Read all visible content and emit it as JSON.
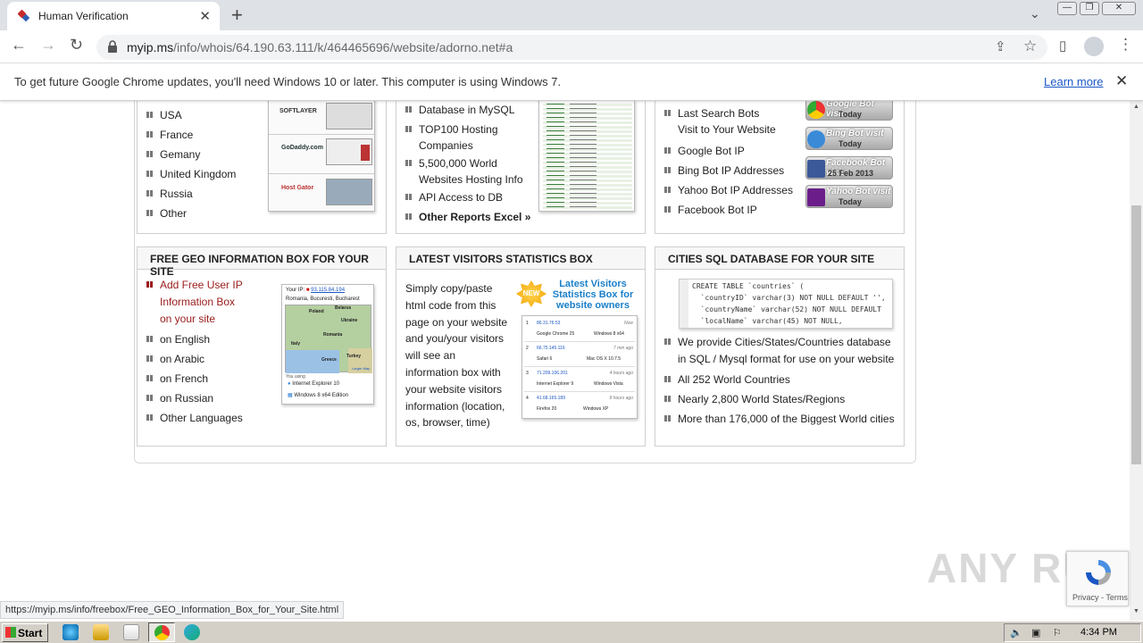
{
  "browser": {
    "tab_title": "Human Verification",
    "tab_close": "✕",
    "new_tab": "+",
    "tab_search": "⌄",
    "win_min": "—",
    "win_max": "❐",
    "win_close": "✕",
    "url_host": "myip.ms",
    "url_path": "/info/whois/64.190.63.111/k/464465696/website/adorno.net#a",
    "back": "←",
    "forward": "→",
    "reload": "↻",
    "share": "⇪",
    "star": "☆",
    "sidepanel": "▯",
    "menu": "⋮"
  },
  "infobar": {
    "message": "To get future Google Chrome updates, you'll need Windows 10 or later. This computer is using Windows 7.",
    "learn_more": "Learn more",
    "close": "✕"
  },
  "top_row": {
    "col1_items": [
      "USA",
      "France",
      "Gemany",
      "United Kingdom",
      "Russia",
      "Other"
    ],
    "col2_items": [
      "Database in MySQL",
      "TOP100 Hosting Companies",
      "5,500,000 World Websites Hosting Info",
      "API Access to DB",
      "Other Reports Excel »"
    ],
    "col2_item1_line1": "TOP100 Hosting",
    "col2_item1_line2": "Companies",
    "col2_item2_line1": "5,500,000 World",
    "col2_item2_line2": "Websites Hosting Info",
    "col3_lastbots_line1": "Last Search Bots",
    "col3_lastbots_line2": "Visit to Your Website",
    "col3_items": [
      "Google Bot IP",
      "Bing Bot IP Addresses",
      "Yahoo Bot IP Addresses",
      "Facebook Bot IP"
    ],
    "thumb1_labels": [
      "SOFTLAYER",
      "GoDaddy.com",
      "Host Gator"
    ],
    "badges": [
      {
        "t1": "Google Bot visit",
        "t2": "Today"
      },
      {
        "t1": "Bing Bot visit",
        "t2": "Today"
      },
      {
        "t1": "Facebook Bot visit",
        "t2": "25 Feb 2013"
      },
      {
        "t1": "Yahoo Bot visit",
        "t2": "Today"
      }
    ]
  },
  "geo_box": {
    "title": "FREE GEO INFORMATION BOX FOR YOUR SITE",
    "add_line1": "Add Free User IP",
    "add_line2": "Information Box",
    "add_line3": "on your site",
    "items": [
      "on English",
      "on Arabic",
      "on French",
      "on Russian",
      "Other Languages"
    ],
    "preview_ip_label": "Your IP:",
    "preview_ip": "93.115.84.194",
    "preview_location": "Romania, Bucuresti, Bucharest",
    "preview_using": "You using",
    "preview_browser": "Internet Explorer 10",
    "preview_os": "Windows 8 x64 Edition",
    "preview_map_labels": [
      "Poland",
      "Belarus",
      "Ukraine",
      "Romania",
      "Italy",
      "Greece",
      "Turkey"
    ],
    "preview_larger_map": "Larger Map"
  },
  "visitors_box": {
    "title": "LATEST VISITORS STATISTICS BOX",
    "text_lines": [
      "Simply copy/paste",
      "html code from this",
      "page on your website",
      "and you/your visitors",
      "will see an",
      "information box with",
      "your website visitors",
      "information (location,",
      "os, browser, time)"
    ],
    "new_badge": "NEW",
    "promo_line1": "Latest Visitors",
    "promo_line2": "Statistics Box for",
    "promo_line3": "website owners",
    "rows": [
      {
        "n": "1",
        "ip": "86.31.76.53",
        "time": "Now",
        "browser": "Google Chrome 25",
        "os": "Windows 8 x64"
      },
      {
        "n": "2",
        "ip": "66.75.145.116",
        "time": "7 min ago",
        "browser": "Safari 6",
        "os": "Mac OS X 10.7.5"
      },
      {
        "n": "3",
        "ip": "71.209.106.201",
        "time": "4 hours ago",
        "browser": "Internet Explorer 9",
        "os": "Windows Vista"
      },
      {
        "n": "4",
        "ip": "41.68.165.189",
        "time": "8 hours ago",
        "browser": "Firefox 20",
        "os": "Windows XP"
      }
    ]
  },
  "cities_box": {
    "title": "CITIES SQL DATABASE FOR YOUR SITE",
    "code_lines": [
      "CREATE TABLE `countries` (",
      "  `countryID` varchar(3) NOT NULL DEFAULT '',",
      "  `countryName` varchar(52) NOT NULL DEFAULT",
      "  `localName` varchar(45) NOT NULL,"
    ],
    "item1_line1": "We provide Cities/States/Countries database",
    "item1_line2": "in SQL / Mysql format for use on your website",
    "items": [
      "All 252 World Countries",
      "Nearly 2,800 World States/Regions",
      "More than 176,000 of the Biggest World cities"
    ]
  },
  "status_url": "https://myip.ms/info/freebox/Free_GEO_Information_Box_for_Your_Site.html",
  "recaptcha_text": "Privacy - Terms",
  "watermark": "ANY RUN",
  "taskbar": {
    "start": "Start",
    "clock": "4:34 PM"
  },
  "colors": {
    "accent_red": "#9b1b1b",
    "link_blue": "#1a56c4",
    "chrome_tabstrip": "#dee1e6"
  }
}
